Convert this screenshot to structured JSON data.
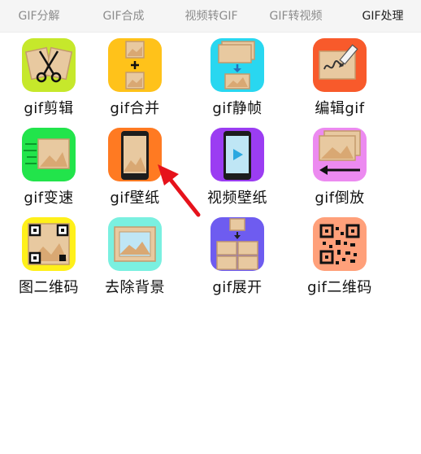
{
  "tabs": [
    {
      "label": "GIF分解"
    },
    {
      "label": "GIF合成"
    },
    {
      "label": "视频转GIF"
    },
    {
      "label": "GIF转视频"
    },
    {
      "label": "GIF处理"
    }
  ],
  "active_tab": "GIF处理",
  "colors": {
    "active_indicator": "#f2579a",
    "annotation_arrow": "#e6121b",
    "photo_tan": "#e8c9a0"
  },
  "tools": [
    {
      "label": "gif剪辑",
      "icon": "scissors-icon",
      "color": "#c6e82b"
    },
    {
      "label": "gif合并",
      "icon": "merge-icon",
      "color": "#ffc21a"
    },
    {
      "label": "gif静帧",
      "icon": "still-frame-icon",
      "color": "#29d7f0"
    },
    {
      "label": "编辑gif",
      "icon": "edit-pen-icon",
      "color": "#f85a2b"
    },
    {
      "label": "gif变速",
      "icon": "speed-icon",
      "color": "#22e44b"
    },
    {
      "label": "gif壁纸",
      "icon": "phone-wallpaper-icon",
      "color": "#ff7a22"
    },
    {
      "label": "视频壁纸",
      "icon": "video-wallpaper-icon",
      "color": "#9b3df2"
    },
    {
      "label": "gif倒放",
      "icon": "reverse-icon",
      "color": "#ec8af0"
    },
    {
      "label": "图二维码",
      "icon": "image-qr-icon",
      "color": "#fff01a"
    },
    {
      "label": "去除背景",
      "icon": "remove-background-icon",
      "color": "#7af0e0"
    },
    {
      "label": "gif展开",
      "icon": "expand-icon",
      "color": "#6e5cf0"
    },
    {
      "label": "gif二维码",
      "icon": "gif-qr-icon",
      "color": "#ffa07a"
    }
  ]
}
